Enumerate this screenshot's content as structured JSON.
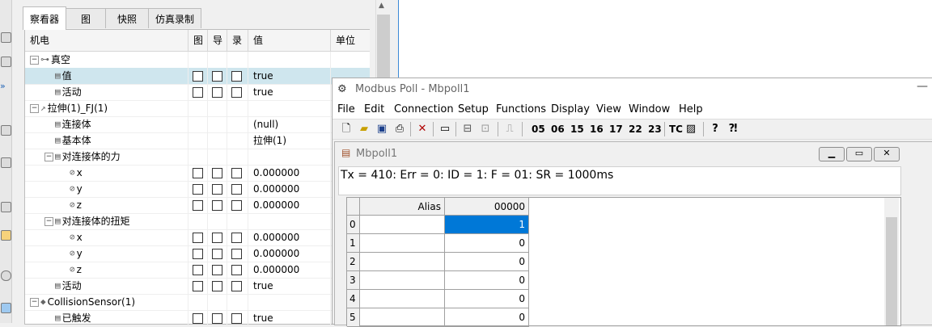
{
  "tabs": [
    "察看器",
    "图",
    "快照",
    "仿真录制"
  ],
  "tree": {
    "columns": [
      "机电",
      "图",
      "导",
      "录",
      "值",
      "单位"
    ],
    "rows": [
      {
        "indent": 0,
        "expander": "−",
        "glyph": "⊶",
        "label": "真空",
        "checks": false,
        "value": "",
        "selected": false
      },
      {
        "indent": 1,
        "expander": "",
        "glyph": "▤",
        "label": "值",
        "checks": true,
        "value": "true",
        "selected": true
      },
      {
        "indent": 1,
        "expander": "",
        "glyph": "▤",
        "label": "活动",
        "checks": true,
        "value": "true",
        "selected": false
      },
      {
        "indent": 0,
        "expander": "−",
        "glyph": "↗",
        "label": "拉伸(1)_FJ(1)",
        "checks": false,
        "value": "",
        "selected": false
      },
      {
        "indent": 1,
        "expander": "",
        "glyph": "▤",
        "label": "连接体",
        "checks": false,
        "value": "(null)",
        "selected": false
      },
      {
        "indent": 1,
        "expander": "",
        "glyph": "▤",
        "label": "基本体",
        "checks": false,
        "value": "拉伸(1)",
        "selected": false
      },
      {
        "indent": 1,
        "expander": "−",
        "glyph": "▤",
        "label": "对连接体的力",
        "checks": false,
        "value": "",
        "selected": false
      },
      {
        "indent": 2,
        "expander": "",
        "glyph": "⊘",
        "label": "x",
        "checks": true,
        "value": "0.000000",
        "selected": false
      },
      {
        "indent": 2,
        "expander": "",
        "glyph": "⊘",
        "label": "y",
        "checks": true,
        "value": "0.000000",
        "selected": false
      },
      {
        "indent": 2,
        "expander": "",
        "glyph": "⊘",
        "label": "z",
        "checks": true,
        "value": "0.000000",
        "selected": false
      },
      {
        "indent": 1,
        "expander": "−",
        "glyph": "▤",
        "label": "对连接体的扭矩",
        "checks": false,
        "value": "",
        "selected": false
      },
      {
        "indent": 2,
        "expander": "",
        "glyph": "⊘",
        "label": "x",
        "checks": true,
        "value": "0.000000",
        "selected": false
      },
      {
        "indent": 2,
        "expander": "",
        "glyph": "⊘",
        "label": "y",
        "checks": true,
        "value": "0.000000",
        "selected": false
      },
      {
        "indent": 2,
        "expander": "",
        "glyph": "⊘",
        "label": "z",
        "checks": true,
        "value": "0.000000",
        "selected": false
      },
      {
        "indent": 1,
        "expander": "",
        "glyph": "▤",
        "label": "活动",
        "checks": true,
        "value": "true",
        "selected": false
      },
      {
        "indent": 0,
        "expander": "−",
        "glyph": "◆",
        "label": "CollisionSensor(1)",
        "checks": false,
        "value": "",
        "selected": false
      },
      {
        "indent": 1,
        "expander": "",
        "glyph": "▤",
        "label": "已触发",
        "checks": true,
        "value": "true",
        "selected": false
      }
    ]
  },
  "modbus": {
    "title": "Modbus Poll - Mbpoll1",
    "menu": [
      "File",
      "Edit",
      "Connection",
      "Setup",
      "Functions",
      "Display",
      "View",
      "Window",
      "Help"
    ],
    "toolbar_codes": [
      "05",
      "06",
      "15",
      "16",
      "17",
      "22",
      "23"
    ],
    "toolbar_tc": "TC",
    "child_title": "Mbpoll1",
    "status": "Tx = 410: Err = 0: ID = 1: F = 01: SR = 1000ms",
    "grid": {
      "alias_header": "Alias",
      "col_header": "00000",
      "rows": [
        {
          "idx": "0",
          "alias": "",
          "value": "1",
          "selected": true
        },
        {
          "idx": "1",
          "alias": "",
          "value": "0",
          "selected": false
        },
        {
          "idx": "2",
          "alias": "",
          "value": "0",
          "selected": false
        },
        {
          "idx": "3",
          "alias": "",
          "value": "0",
          "selected": false
        },
        {
          "idx": "4",
          "alias": "",
          "value": "0",
          "selected": false
        },
        {
          "idx": "5",
          "alias": "",
          "value": "0",
          "selected": false
        }
      ]
    }
  },
  "colors": {
    "accent": "#0078d7",
    "selected_row": "#cfe6ee"
  }
}
